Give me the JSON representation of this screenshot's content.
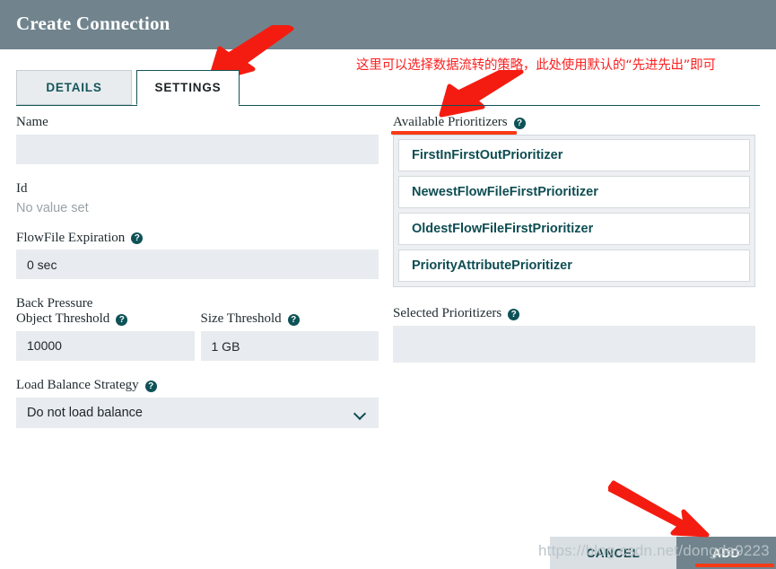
{
  "header": {
    "title": "Create Connection"
  },
  "tabs": [
    {
      "label": "DETAILS",
      "active": false
    },
    {
      "label": "SETTINGS",
      "active": true
    }
  ],
  "form": {
    "name": {
      "label": "Name",
      "value": "",
      "placeholder": ""
    },
    "id": {
      "label": "Id",
      "value": "No value set"
    },
    "flowfile_expiration": {
      "label": "FlowFile Expiration",
      "help": "?",
      "value": "0 sec"
    },
    "back_pressure": {
      "group_label": "Back Pressure",
      "object_threshold": {
        "label": "Object Threshold",
        "help": "?",
        "value": "10000"
      },
      "size_threshold": {
        "label": "Size Threshold",
        "help": "?",
        "value": "1 GB"
      }
    },
    "load_balance_strategy": {
      "label": "Load Balance Strategy",
      "help": "?",
      "value": "Do not load balance",
      "chevron_icon": "chevron-down-icon"
    }
  },
  "prioritizers": {
    "available_label": "Available Prioritizers",
    "available_help": "?",
    "available_items": [
      "FirstInFirstOutPrioritizer",
      "NewestFlowFileFirstPrioritizer",
      "OldestFlowFileFirstPrioritizer",
      "PriorityAttributePrioritizer"
    ],
    "selected_label": "Selected Prioritizers",
    "selected_help": "?",
    "selected_items": []
  },
  "footer": {
    "cancel_label": "CANCEL",
    "add_label": "ADD"
  },
  "annotations": {
    "note_text": "这里可以选择数据流转的策略，此处使用默认的“先进先出”即可",
    "arrows": [
      {
        "name": "arrow-to-settings-tab"
      },
      {
        "name": "arrow-to-available-prioritizers"
      },
      {
        "name": "arrow-to-add-button"
      }
    ],
    "color": "#fc2020",
    "underline_color": "#f93a16"
  },
  "watermark": {
    "text": "https://blog.csdn.net/dongde9223"
  },
  "colors": {
    "header_bg": "#71848d",
    "tab_active_border": "#13555a",
    "input_bg": "#e8ebef",
    "accent_teal": "#0e4d52",
    "annotation_red": "#fc2020"
  }
}
